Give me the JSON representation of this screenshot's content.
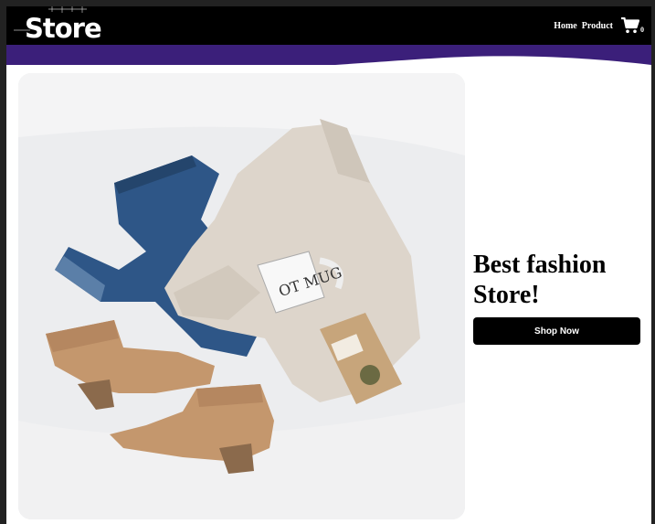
{
  "brand": {
    "name": "Store"
  },
  "nav": {
    "items": [
      {
        "label": "Home"
      },
      {
        "label": "Product"
      }
    ],
    "cart_icon": "cart-icon",
    "cart_count": "0"
  },
  "hero": {
    "image_icon": "fashion-flatlay-image",
    "headline": "Best fashion Store!",
    "cta_label": "Shop Now"
  },
  "colors": {
    "navbar": "#000000",
    "accent_wave": "#3b1f7a",
    "button": "#000000",
    "page_background": "#ffffff"
  }
}
